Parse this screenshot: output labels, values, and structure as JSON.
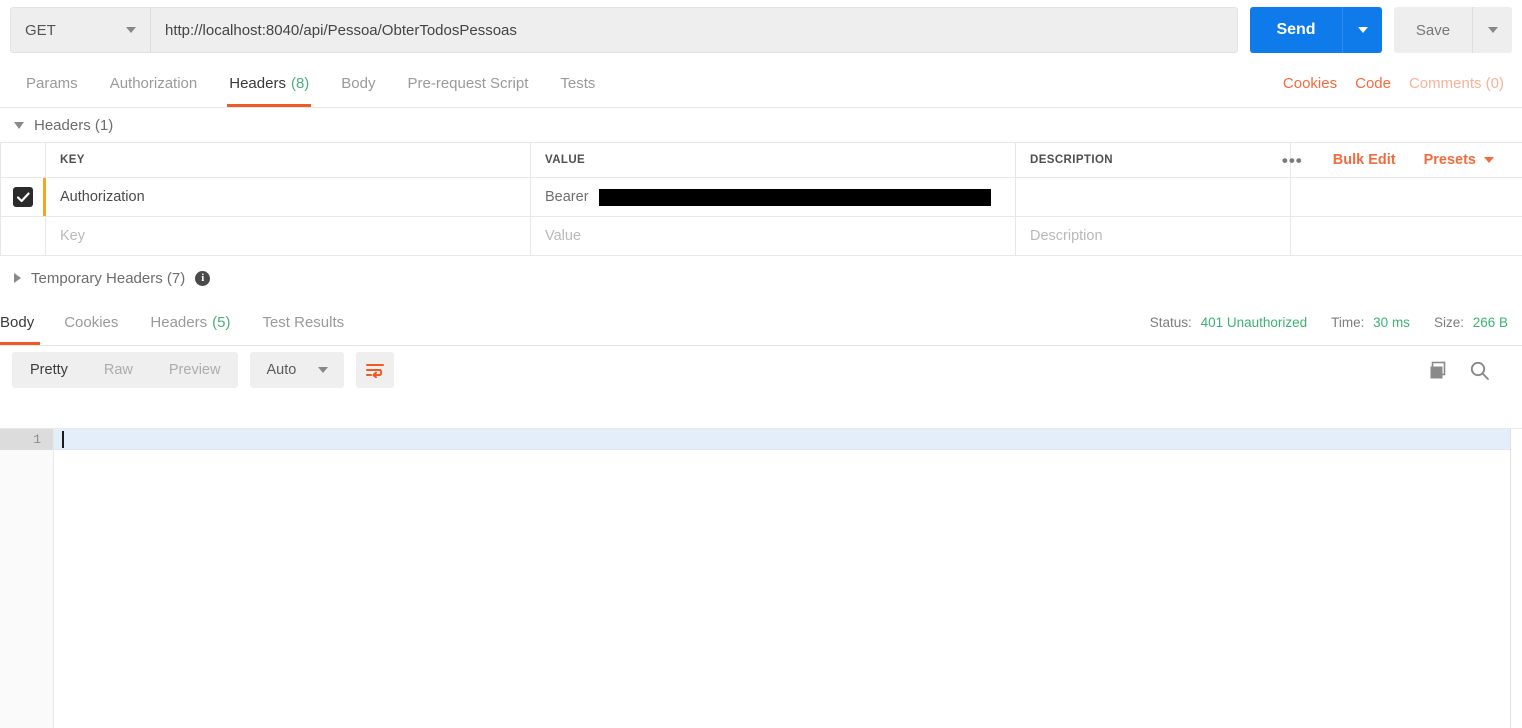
{
  "request": {
    "method": "GET",
    "url": "http://localhost:8040/api/Pessoa/ObterTodosPessoas",
    "send_label": "Send",
    "save_label": "Save",
    "tabs": [
      {
        "label": "Params",
        "count": "",
        "active": false
      },
      {
        "label": "Authorization",
        "count": "",
        "active": false
      },
      {
        "label": "Headers",
        "count": "(8)",
        "active": true
      },
      {
        "label": "Body",
        "count": "",
        "active": false
      },
      {
        "label": "Pre-request Script",
        "count": "",
        "active": false
      },
      {
        "label": "Tests",
        "count": "",
        "active": false
      }
    ],
    "right_links": {
      "cookies": "Cookies",
      "code": "Code",
      "comments": "Comments (0)"
    }
  },
  "headers_section": {
    "title": "Headers (1)",
    "columns": {
      "key": "KEY",
      "value": "VALUE",
      "description": "DESCRIPTION"
    },
    "tools": {
      "more": "•••",
      "bulk_edit": "Bulk Edit",
      "presets": "Presets"
    },
    "rows": [
      {
        "checked": true,
        "key": "Authorization",
        "value_prefix": "Bearer",
        "value_redacted": true,
        "description": ""
      }
    ],
    "placeholder_row": {
      "key": "Key",
      "value": "Value",
      "description": "Description"
    },
    "temporary": {
      "title": "Temporary Headers (7)",
      "info_glyph": "i"
    }
  },
  "response": {
    "tabs": [
      {
        "label": "Body",
        "count": "",
        "active": true
      },
      {
        "label": "Cookies",
        "count": "",
        "active": false
      },
      {
        "label": "Headers",
        "count": "(5)",
        "active": false
      },
      {
        "label": "Test Results",
        "count": "",
        "active": false
      }
    ],
    "status": {
      "status_label": "Status:",
      "status_value": "401 Unauthorized",
      "time_label": "Time:",
      "time_value": "30 ms",
      "size_label": "Size:",
      "size_value": "266 B"
    },
    "format_bar": {
      "pretty": "Pretty",
      "raw": "Raw",
      "preview": "Preview",
      "language": "Auto"
    },
    "body": {
      "line_number": "1",
      "content": ""
    }
  },
  "colors": {
    "accent_orange": "#ef5b25",
    "link_orange": "#f26b3f",
    "send_blue": "#0f7beb",
    "count_green": "#4caf7d",
    "status_green": "#3bb273",
    "row_accent": "#f5a623"
  }
}
